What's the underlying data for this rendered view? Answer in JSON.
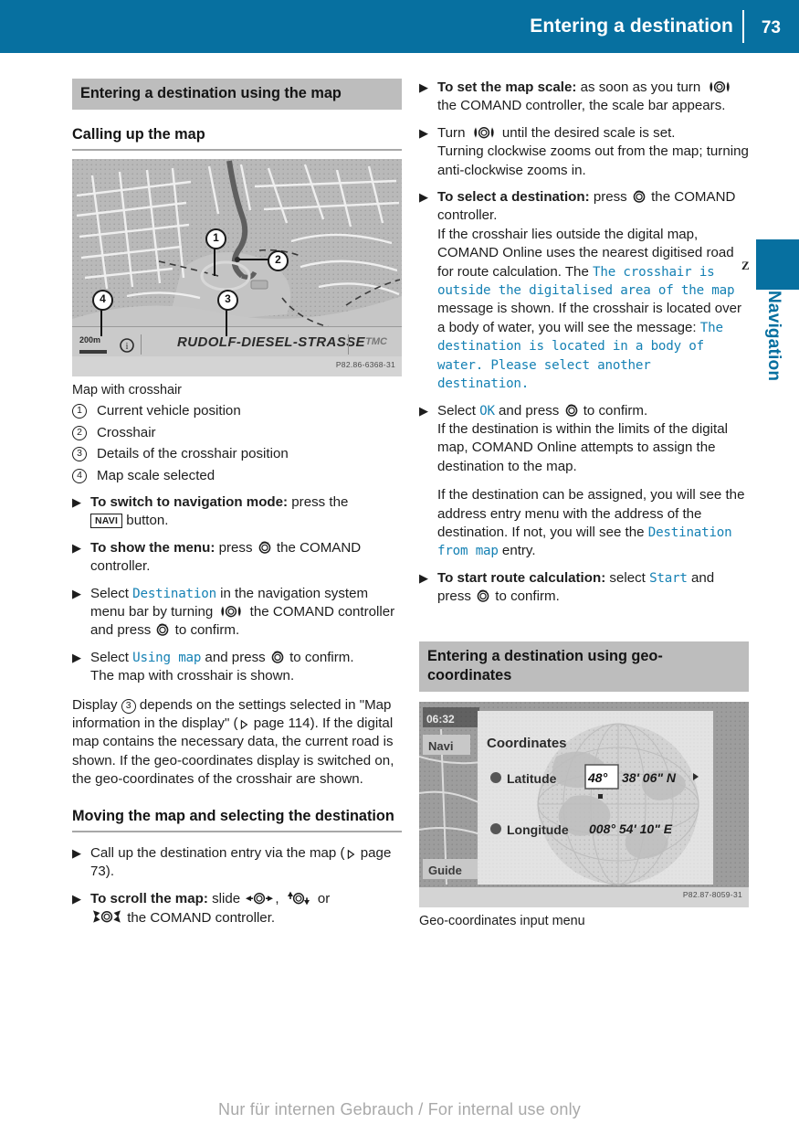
{
  "header": {
    "title": "Entering a destination",
    "page_number": "73"
  },
  "thumb_tab": {
    "label": "Navigation",
    "mark": "Z"
  },
  "footer": {
    "text": "Nur für internen Gebrauch / For internal use only"
  },
  "left_column": {
    "section_heading": "Entering a destination using the map",
    "sub_heading_1": "Calling up the map",
    "map_figure": {
      "caption": "Map with crosshair",
      "street_label": "RUDOLF-DIESEL-STRASSE",
      "scale_label": "200m",
      "tmc_label": "TMC",
      "image_code": "P82.86-6368-31",
      "callouts": [
        "1",
        "2",
        "3",
        "4"
      ]
    },
    "legend": [
      {
        "num": "1",
        "text": "Current vehicle position"
      },
      {
        "num": "2",
        "text": "Crosshair"
      },
      {
        "num": "3",
        "text": "Details of the crosshair position"
      },
      {
        "num": "4",
        "text": "Map scale selected"
      }
    ],
    "steps": {
      "s1_bold": "To switch to navigation mode:",
      "s1_rest": " press the",
      "s1_key": "NAVI",
      "s1_tail": " button.",
      "s2_bold": "To show the menu:",
      "s2_rest_a": " press ",
      "s2_rest_b": " the COMAND controller.",
      "s3_a": "Select ",
      "s3_screen": "Destination",
      "s3_b": " in the navigation system menu bar by turning ",
      "s3_c": " the COMAND controller and press ",
      "s3_d": " to confirm.",
      "s4_a": "Select ",
      "s4_screen": "Using map",
      "s4_b": " and press ",
      "s4_c": " to confirm.",
      "s4_sub": "The map with crosshair is shown."
    },
    "note_paragraph": {
      "a": "Display ",
      "callout": "3",
      "b": " depends on the settings selected in \"Map information in the display\" (",
      "page_ref": " page 114",
      "c": "). If the digital map contains the necessary data, the current road is shown. If the geo-coordinates display is switched on, the geo-coordinates of the crosshair are shown."
    },
    "sub_heading_2": "Moving the map and selecting the destination",
    "steps_2": {
      "s1_a": "Call up the destination entry via the map (",
      "s1_ref": " page 73",
      "s1_b": ").",
      "s2_bold": "To scroll the map:",
      "s2_a": " slide ",
      "s2_b": ", ",
      "s2_c": " or ",
      "s2_d": " the COMAND controller."
    }
  },
  "right_column": {
    "steps": {
      "r1_bold": "To set the map scale:",
      "r1_a": " as soon as you turn ",
      "r1_b": " the COMAND controller, the scale bar appears.",
      "r2_a": "Turn ",
      "r2_b": " until the desired scale is set.",
      "r2_sub": "Turning clockwise zooms out from the map; turning anti-clockwise zooms in.",
      "r3_bold": "To select a destination:",
      "r3_a": " press ",
      "r3_b": " the COMAND controller.",
      "r3_sub_a": "If the crosshair lies outside the digital map, COMAND Online uses the nearest digitised road for route calculation. The ",
      "r3_msg1": "The crosshair is outside the digitalised area of the map",
      "r3_sub_b": " message is shown. If the crosshair is located over a body of water, you will see the message: ",
      "r3_msg2": "The destination is located in a body of water. Please select another destination.",
      "r4_a": "Select ",
      "r4_screen": "OK",
      "r4_b": " and press ",
      "r4_c": " to confirm.",
      "r4_sub": "If the destination is within the limits of the digital map, COMAND Online attempts to assign the destination to the map.",
      "r4_para": "If the destination can be assigned, you will see the address entry menu with the address of the destination. If not, you will see the ",
      "r4_screen2": "Destination from map",
      "r4_para_tail": " entry.",
      "r5_bold": "To start route calculation:",
      "r5_a": " select ",
      "r5_screen": "Start",
      "r5_b": " and press ",
      "r5_c": " to confirm."
    },
    "section_heading": "Entering a destination using geo-coordinates",
    "geo_figure": {
      "caption": "Geo-coordinates input menu",
      "image_code": "P82.87-8059-31",
      "screen": {
        "clock": "06:32",
        "left_menu_top": "Navi",
        "left_menu_bottom": "Guide",
        "dialog_title": "Coordinates",
        "rows": [
          {
            "label": "Latitude",
            "value_highlight": "48°",
            "value_rest": "38' 06\" N"
          },
          {
            "label": "Longitude",
            "value_highlight": "",
            "value_rest": "008° 54' 10\" E"
          }
        ]
      }
    }
  },
  "colors": {
    "brand_blue": "#0770a0",
    "screen_text_blue": "#1581b4",
    "section_band_gray": "#bdbdbd"
  }
}
